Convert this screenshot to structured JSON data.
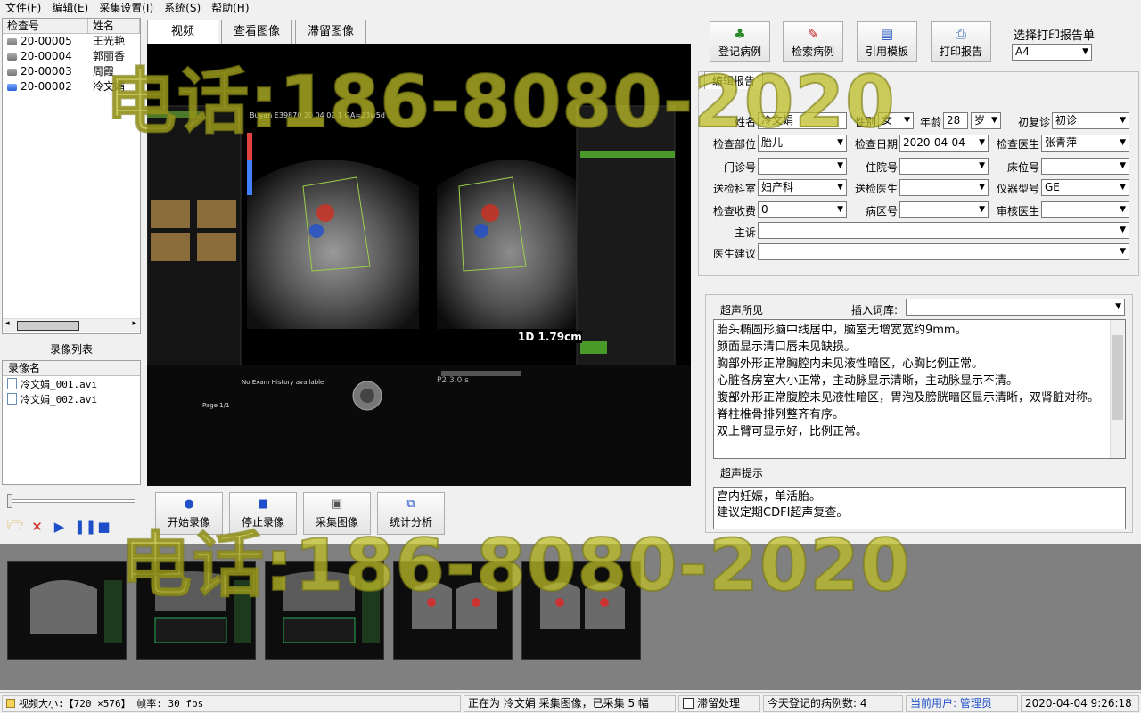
{
  "menu": [
    "文件(F)",
    "编辑(E)",
    "采集设置(I)",
    "系统(S)",
    "帮助(H)"
  ],
  "patient_list": {
    "headers": [
      "检查号",
      "姓名"
    ],
    "rows": [
      {
        "id": "20-00005",
        "name": "王光艳"
      },
      {
        "id": "20-00004",
        "name": "郭丽香"
      },
      {
        "id": "20-00003",
        "name": "周霞"
      },
      {
        "id": "20-00002",
        "name": "冷文娟"
      }
    ]
  },
  "recordings": {
    "title": "录像列表",
    "header": "录像名",
    "items": [
      "冷文娟_001.avi",
      "冷文娟_002.avi"
    ]
  },
  "tabs": [
    "视频",
    "查看图像",
    "滞留图像"
  ],
  "ultrasound": {
    "header": "Buyan E39870 20 04 02 1 GA=23w5d",
    "measure": "1D 1.79cm",
    "no_history": "No Exam History available",
    "page": "Page 1/1"
  },
  "capture_buttons": [
    "开始录像",
    "停止录像",
    "采集图像",
    "统计分析"
  ],
  "toolbar": {
    "buttons": [
      "登记病例",
      "检索病例",
      "引用模板",
      "打印报告"
    ],
    "print_label": "选择打印报告单",
    "print_value": "A4"
  },
  "report": {
    "tab": "编辑报告",
    "labels": {
      "name": "姓名",
      "gender": "性别",
      "age": "年龄",
      "visit": "初复诊",
      "part": "检查部位",
      "date": "检查日期",
      "doctor": "检查医生",
      "outpatient": "门诊号",
      "inpatient": "住院号",
      "bed": "床位号",
      "dept": "送检科室",
      "send_doc": "送检医生",
      "device": "仪器型号",
      "fee": "检查收费",
      "ward": "病区号",
      "reviewer": "审核医生",
      "complaint": "主诉",
      "advice": "医生建议"
    },
    "values": {
      "name": "冷文娟",
      "gender": "女",
      "age": "28",
      "age_unit": "岁",
      "visit": "初诊",
      "part": "胎儿",
      "date": "2020-04-04",
      "doctor": "张青萍",
      "outpatient": "",
      "inpatient": "",
      "bed": "",
      "dept": "妇产科",
      "send_doc": "",
      "device": "GE",
      "fee": "0",
      "ward": "",
      "reviewer": "",
      "complaint": "",
      "advice": ""
    }
  },
  "findings": {
    "label": "超声所见",
    "insert_label": "插入词库:",
    "text": "胎头椭圆形脑中线居中，脑室无增宽宽约9mm。\n颜面显示清口唇未见缺损。\n胸部外形正常胸腔内未见液性暗区，心胸比例正常。\n心脏各房室大小正常，主动脉显示清晰，主动脉显示不清。\n腹部外形正常腹腔未见液性暗区，胃泡及膀胱暗区显示清晰，双肾脏对称。\n脊柱椎骨排列整齐有序。\n双上臂可显示好，比例正常。",
    "hint_label": "超声提示",
    "hint_text": "宫内妊娠，单活胎。\n建议定期CDFI超声复查。"
  },
  "status": {
    "video": "视频大小:【720 ×576】 帧率: 30 fps",
    "capture": "正在为 冷文娟 采集图像，已采集 5 幅",
    "retain": "滞留处理",
    "today": "今天登记的病例数: 4",
    "user": "当前用户: 管理员",
    "time": "2020-04-04  9:26:18"
  },
  "watermark": "电话:186-8080-2020"
}
